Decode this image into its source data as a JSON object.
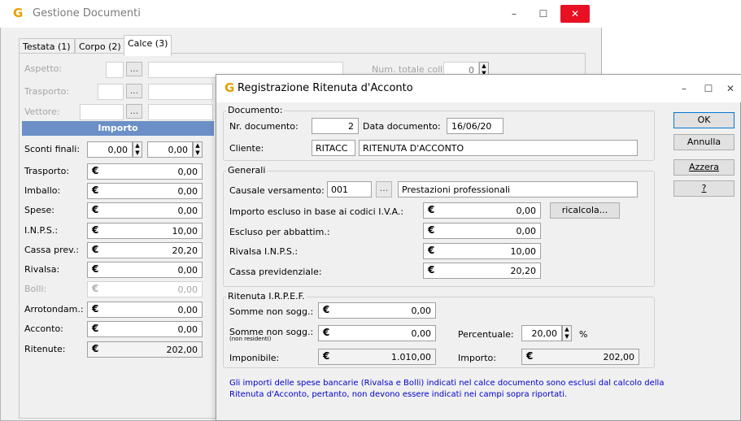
{
  "main_window": {
    "title": "Gestione Documenti",
    "logo": "G",
    "controls": {
      "minimize": "–",
      "maximize": "☐",
      "close": "✕"
    },
    "tabs": [
      "Testata (1)",
      "Corpo (2)",
      "Calce (3)"
    ],
    "aspetto_label": "Aspetto:",
    "trasporto_label": "Trasporto:",
    "vettore_label": "Vettore:",
    "num_colli_label": "Num. totale colli:",
    "num_colli_value": "0",
    "dots": "...",
    "importo_header": "Importo",
    "sconti_label": "Sconti finali:",
    "sconti_value1": "0,00",
    "sconti_value2": "0,00",
    "rows": [
      {
        "label": "Trasporto:",
        "value": "0,00"
      },
      {
        "label": "Imballo:",
        "value": "0,00"
      },
      {
        "label": "Spese:",
        "value": "0,00"
      },
      {
        "label": "I.N.P.S.:",
        "value": "10,00"
      },
      {
        "label": "Cassa prev.:",
        "value": "20,20"
      },
      {
        "label": "Rivalsa:",
        "value": "0,00"
      },
      {
        "label": "Bolli:",
        "value": "0,00"
      },
      {
        "label": "Arrotondam.:",
        "value": "0,00"
      },
      {
        "label": "Acconto:",
        "value": "0,00"
      },
      {
        "label": "Ritenute:",
        "value": "202,00"
      }
    ],
    "currency": "€"
  },
  "dialog": {
    "title": "Registrazione Ritenuta d'Acconto",
    "logo": "G",
    "controls": {
      "minimize": "–",
      "maximize": "☐",
      "close": "✕"
    },
    "documento_group": "Documento:",
    "nr_label": "Nr. documento:",
    "nr_value": "2",
    "data_label": "Data documento:",
    "data_value": "16/06/20",
    "cliente_label": "Cliente:",
    "cliente_code": "RITACC",
    "cliente_name": "RITENUTA D'ACCONTO",
    "generali_group": "Generali",
    "causale_label": "Causale versamento:",
    "causale_code": "001",
    "causale_desc": "Prestazioni professionali",
    "escluso_iva_label": "Importo escluso in base ai codici I.V.A.:",
    "escluso_iva_value": "0,00",
    "ricalcola_label": "ricalcola...",
    "abbattim_label": "Escluso per abbattim.:",
    "abbattim_value": "0,00",
    "rivalsa_label": "Rivalsa I.N.P.S.:",
    "rivalsa_value": "10,00",
    "cassa_label": "Cassa previdenziale:",
    "cassa_value": "20,20",
    "irpef_group": "Ritenuta I.R.P.E.F.",
    "somme_label": "Somme non sogg.:",
    "somme_value": "0,00",
    "somme_nr_label": "Somme non sogg.:",
    "somme_nr_sub": "(non residenti)",
    "somme_nr_value": "0,00",
    "percentuale_label": "Percentuale:",
    "percentuale_value": "20,00",
    "percent_sign": "%",
    "imponibile_label": "Imponibile:",
    "imponibile_value": "1.010,00",
    "importo_label": "Importo:",
    "importo_value": "202,00",
    "currency": "€",
    "dots": "...",
    "buttons": {
      "ok": "OK",
      "annulla": "Annulla",
      "azzera": "Azzera",
      "help": "?"
    },
    "note": "Gli importi delle spese bancarie (Rivalsa e Bolli) indicati nel calce documento sono esclusi dal calcolo della Ritenuta d'Acconto, pertanto, non devono essere indicati nei campi sopra riportati."
  }
}
